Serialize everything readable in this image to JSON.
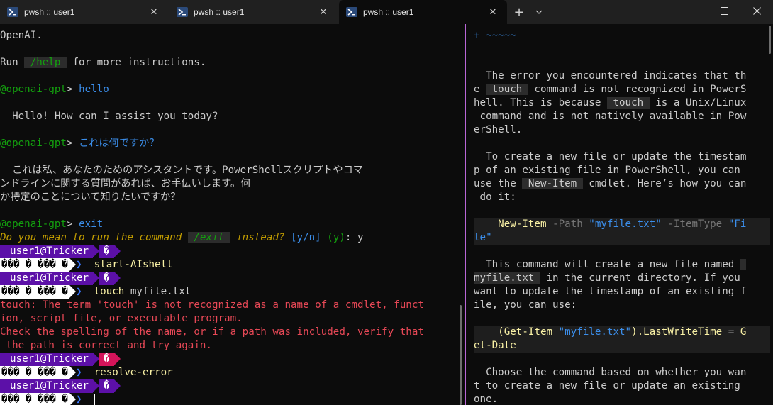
{
  "tabs": [
    {
      "title": "pwsh :: user1",
      "active": false
    },
    {
      "title": "pwsh :: user1",
      "active": false
    },
    {
      "title": "pwsh :: user1",
      "active": true
    }
  ],
  "left": {
    "l1": "OpenAI.",
    "run_prefix": "Run ",
    "help_cmd": " /help ",
    "run_suffix": " for more instructions.",
    "prompt_name": "@openai-gpt",
    "prompt_gt": "> ",
    "q1": "hello",
    "a1": "  Hello! How can I assist you today?",
    "q2": "これは何ですか？",
    "a2_1": "  これは私、あなたのためのアシスタントです。PowerShellスクリプトやコマ",
    "a2_2": "ンドラインに関する質問があれば、お手伝いします。何",
    "a2_3": "か特定のことについて知りたいですか？",
    "q3": "exit",
    "dym_1": "Do you mean to run the command ",
    "dym_cmd": " /exit ",
    "dym_2": " instead? ",
    "dym_yn": "[y/n]",
    "dym_default": " (y)",
    "dym_colon": ": ",
    "dym_answer": "y",
    "user": "user1@Tricker",
    "glyph": "�",
    "path": "��� � ��� �",
    "chev": "❯",
    "cmd1": "start-AIshell",
    "cmd2_a": "touch",
    "cmd2_b": " myfile.txt",
    "err1": "touch: The term 'touch' is not recognized as a name of a cmdlet, funct",
    "err2": "ion, script file, or executable program.",
    "err3": "Check the spelling of the name, or if a path was included, verify that",
    "err4": " the path is correct and try again.",
    "cmd3": "resolve-error"
  },
  "right": {
    "top": "+ ~~~~~",
    "p1_1a": "  The error you encountered indicates that th",
    "p1_2a": "e ",
    "touch": " touch ",
    "p1_2b": " command is not recognized in PowerS",
    "p1_3a": "hell. This is because ",
    "p1_3b": " is a Unix/Linux",
    "p1_4": " command and is not natively available in Pow",
    "p1_5": "erShell.",
    "p2_1": "  To create a new file or update the timestam",
    "p2_2": "p of an existing file in PowerShell, you can",
    "p2_3a": "use the ",
    "newitem": " New-Item ",
    "p2_3b": " cmdlet. Here’s how you can",
    "p2_4": " do it:",
    "code1_cmd": "    New-Item",
    "code1_p1": " -Path ",
    "code1_s1": "\"myfile.txt\"",
    "code1_p2": " -ItemType ",
    "code1_s2a": "\"Fi",
    "code1_s2b": "le\"",
    "p3_1a": "  This command will create a new file named ",
    "p3_2a": "myfile.txt ",
    "p3_2b": " in the current directory. If you",
    "p3_3": "want to update the timestamp of an existing f",
    "p3_4": "ile, you can use:",
    "code2_a": "    (Get-Item ",
    "code2_s": "\"myfile.txt\"",
    "code2_b": ").LastWriteTime ",
    "code2_eq": "=",
    "code2_c": " G",
    "code2_d": "et-Date",
    "p4_1": "  Choose the command based on whether you wan",
    "p4_2": "t to create a new file or update an existing",
    "p4_3": "one."
  }
}
